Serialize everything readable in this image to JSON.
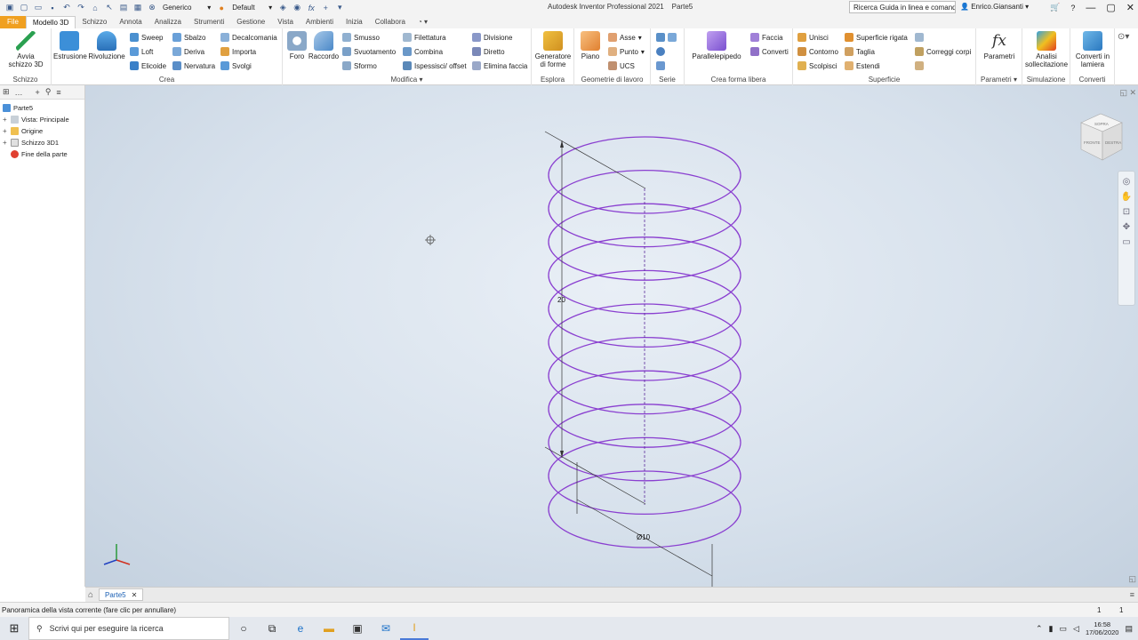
{
  "titlebar": {
    "appearance": "Generico",
    "style": "Default",
    "app_title": "Autodesk Inventor Professional 2021",
    "doc_name": "Parte5",
    "search_placeholder": "Ricerca Guida in linea e comand",
    "user": "Enrico.Giansanti"
  },
  "tabs": [
    "File",
    "Modello 3D",
    "Schizzo",
    "Annota",
    "Analizza",
    "Strumenti",
    "Gestione",
    "Vista",
    "Ambienti",
    "Inizia",
    "Collabora"
  ],
  "ribbon": {
    "schizzo": {
      "avvia": "Avvia",
      "avvia2": "schizzo 3D",
      "label": "Schizzo"
    },
    "crea": {
      "estrusione": "Estrusione",
      "rivoluzione": "Rivoluzione",
      "sweep": "Sweep",
      "loft": "Loft",
      "elicoide": "Elicoide",
      "sbalzo": "Sbalzo",
      "deriva": "Deriva",
      "nervatura": "Nervatura",
      "decalcomania": "Decalcomania",
      "importa": "Importa",
      "svolgi": "Svolgi",
      "label": "Crea"
    },
    "modifica": {
      "foro": "Foro",
      "raccordo": "Raccordo",
      "smusso": "Smusso",
      "svuotamento": "Svuotamento",
      "sformo": "Sformo",
      "filettatura": "Filettatura",
      "combina": "Combina",
      "ispessisci": "Ispessisci/ offset",
      "divisione": "Divisione",
      "diretto": "Diretto",
      "elimina_faccia": "Elimina faccia",
      "label": "Modifica"
    },
    "esplora": {
      "gen1": "Generatore",
      "gen2": "di forme",
      "label": "Esplora"
    },
    "geometrie": {
      "piano": "Piano",
      "asse": "Asse",
      "punto": "Punto",
      "ucs": "UCS",
      "label": "Geometrie di lavoro"
    },
    "serie": {
      "label": "Serie"
    },
    "forma_libera": {
      "parallelepipedo": "Parallelepipedo",
      "faccia": "Faccia",
      "converti": "Converti",
      "label": "Crea forma libera"
    },
    "superficie": {
      "unisci": "Unisci",
      "contorno": "Contorno",
      "scolpisci": "Scolpisci",
      "rigata": "Superficie rigata",
      "taglia": "Taglia",
      "estendi": "Estendi",
      "correggi": "Correggi corpi",
      "label": "Superficie"
    },
    "parametri": {
      "btn": "Parametri",
      "label": "Parametri"
    },
    "simulazione": {
      "a1": "Analisi",
      "a2": "sollecitazione",
      "label": "Simulazione"
    },
    "converti": {
      "c1": "Converti in",
      "c2": "lamiera",
      "label": "Converti"
    }
  },
  "browser": {
    "nodes": [
      "Parte5",
      "Vista: Principale",
      "Origine",
      "Schizzo 3D1",
      "Fine della parte"
    ]
  },
  "viewport": {
    "dim_height": "20",
    "dim_diameter": "Ø10",
    "viewcube_top": "SOPRA",
    "viewcube_front": "FRONTE",
    "viewcube_right": "DESTRA"
  },
  "doc_tab": "Parte5",
  "status": {
    "text": "Panoramica della vista corrente (fare clic per annullare)",
    "count1": "1",
    "count2": "1"
  },
  "taskbar": {
    "search": "Scrivi qui per eseguire la ricerca",
    "time": "16:58",
    "date": "17/06/2020"
  },
  "colors": {
    "helix": "#8a3fd0",
    "file_tab": "#f0a020",
    "accent": "#1a5fb4"
  }
}
